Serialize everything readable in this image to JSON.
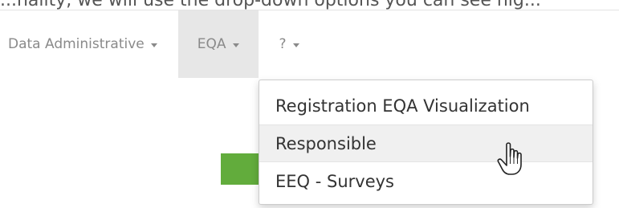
{
  "header": {
    "cut_text": "...nality, we will use the drop-down options you can see hig..."
  },
  "navbar": {
    "items": [
      {
        "label": "Data Administrative"
      },
      {
        "label": "EQA"
      },
      {
        "label": "?"
      }
    ]
  },
  "dropdown": {
    "items": [
      {
        "label": "Registration EQA Visualization"
      },
      {
        "label": "Responsible"
      },
      {
        "label": "EEQ - Surveys"
      }
    ],
    "active_item": "Responsible"
  },
  "colors": {
    "accent_green": "#62ac3c",
    "active_nav_bg": "#e7e7e7",
    "nav_text": "#8a8a8a"
  },
  "icons": {
    "cursor": "hand-pointer-icon"
  }
}
